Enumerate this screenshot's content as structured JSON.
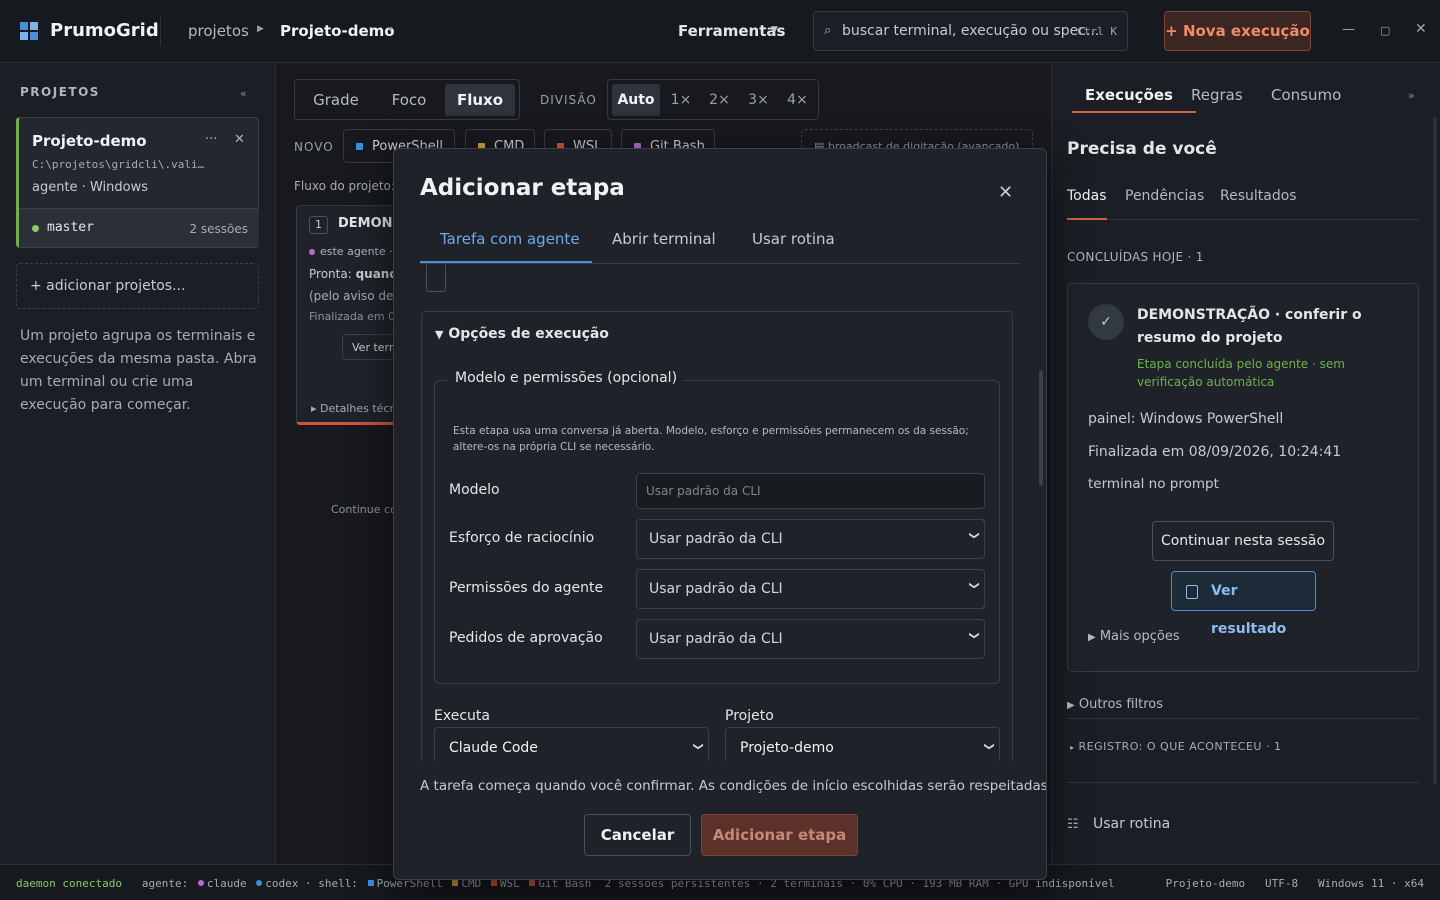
{
  "app": {
    "brand": "PrumoGrid",
    "breadcrumb_root": "projetos",
    "breadcrumb_project": "Projeto-demo",
    "tools_label": "Ferramentas",
    "search_placeholder": "buscar terminal, execução ou spec...",
    "search_shortcut": "Ctrl K",
    "new_execution_label": "+ Nova execução",
    "brand_color": "#4b8fd6",
    "accent_color": "#d2633f"
  },
  "sidebar": {
    "title": "PROJETOS",
    "project": {
      "name": "Projeto-demo",
      "path": "C:\\projetos\\gridcli\\.vali…",
      "meta": "agente · Windows",
      "branch": "master",
      "sessions": "2 sessões"
    },
    "add_projects": "+ adicionar projetos...",
    "help_text": "Um projeto agrupa os terminais e execuções da mesma pasta. Abra um terminal ou crie uma execução para começar."
  },
  "center": {
    "view_tabs": [
      "Grade",
      "Foco",
      "Fluxo"
    ],
    "division_label": "DIVISÃO",
    "division_tabs": [
      "Auto",
      "1×",
      "2×",
      "3×",
      "4×"
    ],
    "new_label": "NOVO",
    "shells": [
      {
        "label": "PowerShell",
        "color": "#3a8fe0"
      },
      {
        "label": "CMD",
        "color": "#d6a23a"
      },
      {
        "label": "WSL",
        "color": "#d0553e"
      },
      {
        "label": "Git Bash",
        "color": "#b56ad0"
      }
    ],
    "broadcast_label": "▤ broadcast de digitação (avançado)",
    "flow_label": "Fluxo do projeto: c",
    "flow_card": {
      "number": "1",
      "title": "DEMONS",
      "agent": "este agente · n",
      "ready_label": "Pronta:",
      "ready_value": "quando",
      "notice": "(pelo aviso dele,",
      "finished": "Finalizada em 08",
      "terminal_button": "Ver term",
      "details": "▸ Detalhes técni"
    },
    "continue_hint": "Continue con"
  },
  "right_panel": {
    "tabs": [
      "Execuções",
      "Regras",
      "Consumo"
    ],
    "title": "Precisa de você",
    "subtabs": [
      "Todas",
      "Pendências",
      "Resultados"
    ],
    "count_label": "CONCLUÍDAS HOJE · 1",
    "card": {
      "title": "DEMONSTRAÇÃO · conferir o resumo do projeto",
      "subtitle": "Etapa concluída pelo agente · sem verificação automática",
      "panel": "painel: Windows PowerShell",
      "finished": "Finalizada em 08/09/2026, 10:24:41",
      "terminal_state": "terminal no prompt",
      "continue_button": "Continuar nesta sessão",
      "result_button": "Ver resultado",
      "more_options": "Mais opções"
    },
    "other_filters": "Outros filtros",
    "log_label": "REGISTRO: O QUE ACONTECEU · 1",
    "use_routine": "Usar rotina"
  },
  "statusbar": {
    "daemon": "daemon conectado",
    "agent_label": "agente:",
    "agent_1": "claude",
    "agent_2": "codex",
    "shell_label": "· shell:",
    "shells": [
      "PowerShell",
      "CMD",
      "WSL",
      "Git Bash"
    ],
    "stats": "2 sessões persistentes · 2 terminais · 0% CPU · 193 MB RAM · GPU indisponível",
    "project": "Projeto-demo",
    "encoding": "UTF-8",
    "os": "Windows 11 · x64"
  },
  "modal": {
    "title": "Adicionar etapa",
    "tabs": [
      "Tarefa com agente",
      "Abrir terminal",
      "Usar rotina"
    ],
    "options_title": "Opções de execução",
    "legend": "Modelo e permissões (opcional)",
    "note": "Esta etapa usa uma conversa já aberta. Modelo, esforço e permissões permanecem os da sessão; altere-os na própria CLI se necessário.",
    "model_label": "Modelo",
    "model_placeholder": "Usar padrão da CLI",
    "effort_label": "Esforço de raciocínio",
    "effort_value": "Usar padrão da CLI",
    "permissions_label": "Permissões do agente",
    "permissions_value": "Usar padrão da CLI",
    "approvals_label": "Pedidos de aprovação",
    "approvals_value": "Usar padrão da CLI",
    "runs_label": "Executa",
    "runs_value": "Claude Code",
    "project_label": "Projeto",
    "project_value": "Projeto-demo",
    "footnote": "A tarefa começa quando você confirmar. As condições de início escolhidas serão respeitadas.",
    "cancel": "Cancelar",
    "confirm": "Adicionar etapa"
  }
}
